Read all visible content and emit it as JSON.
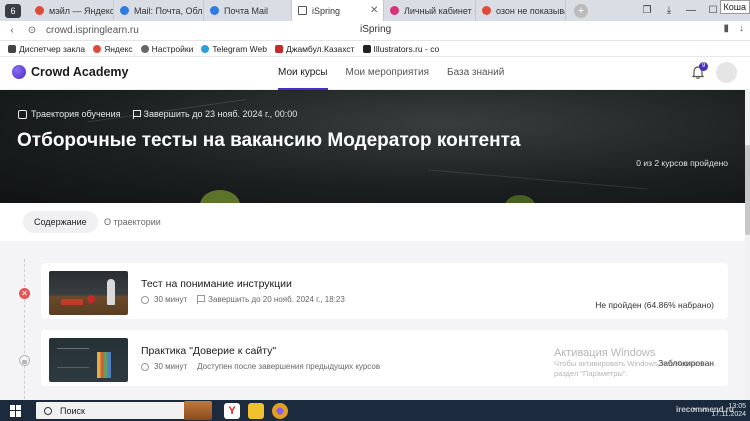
{
  "browser": {
    "tab_counter": "6",
    "tabs": [
      {
        "label": "мэйл — Яндекс: на",
        "color": "#e04a3a"
      },
      {
        "label": "Mail: Почта, Облако",
        "color": "#2f7ae5"
      },
      {
        "label": "Почта Mail",
        "color": "#2f7ae5"
      },
      {
        "label": "iSpring",
        "color": "#555555"
      },
      {
        "label": "Личный кабинет - О",
        "color": "#d9307a"
      },
      {
        "label": "озон не показывает",
        "color": "#e04a3a"
      }
    ],
    "new_tab": "+",
    "profile_tag": "Коша",
    "url": "crowd.ispringlearn.ru",
    "page_title": "iSpring",
    "bookmarks": [
      {
        "label": "Диспетчер закла",
        "color": "#444444"
      },
      {
        "label": "Яндекс",
        "color": "#e04a3a"
      },
      {
        "label": "Настройки",
        "color": "#666666"
      },
      {
        "label": "Telegram Web",
        "color": "#2aa1da"
      },
      {
        "label": "Джамбул.Казахст",
        "color": "#c8292a"
      },
      {
        "label": "Illustrators.ru - со",
        "color": "#222222"
      }
    ]
  },
  "header": {
    "logo_text": "Crowd Academy",
    "nav": [
      "Мои курсы",
      "Мои мероприятия",
      "База знаний"
    ],
    "notification_count": "9"
  },
  "hero": {
    "trajectory_label": "Траектория обучения",
    "deadline": "Завершить до 23 нояб. 2024 г., 00:00",
    "title": "Отборочные тесты на вакансию Модератор контента",
    "progress": "0 из 2 курсов пройдено"
  },
  "subtabs": {
    "active": "Содержание",
    "other": "О траектории"
  },
  "courses": [
    {
      "title": "Тест на понимание инструкции",
      "duration": "30 минут",
      "deadline": "Завершить до 20 нояб. 2024 г., 18:23",
      "status": "Не пройден (64.86% набрано)"
    },
    {
      "title": "Практика \"Доверие к сайту\"",
      "duration": "30 минут",
      "deadline": "Доступен после завершения предыдущих курсов",
      "status": "Заблокирован"
    }
  ],
  "watermark": {
    "line1": "Активация Windows",
    "line2": "Чтобы активировать Windows, перейдите в",
    "line3": "раздел \"Параметры\"."
  },
  "taskbar": {
    "search_label": "Поиск",
    "time": "13:05",
    "date": "17.11.2024",
    "irecommend": "irecommend.ru"
  }
}
